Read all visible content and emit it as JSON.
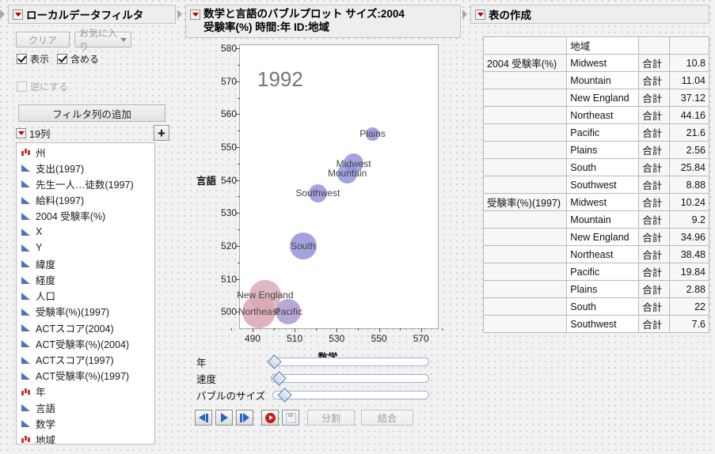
{
  "filter_panel": {
    "title": "ローカルデータフィルタ",
    "clear_label": "クリア",
    "favorites_label": "お気に入り",
    "show_label": "表示",
    "include_label": "含める",
    "invert_label": "逆にする",
    "add_filter_column_label": "フィルタ列の追加",
    "columns_count_label": "19列",
    "plus_label": "+",
    "columns": [
      {
        "label": "州",
        "type": "nominal"
      },
      {
        "label": "支出(1997)",
        "type": "continuous"
      },
      {
        "label": "先生一人…徒数(1997)",
        "type": "continuous"
      },
      {
        "label": "給料(1997)",
        "type": "continuous"
      },
      {
        "label": "2004 受験率(%)",
        "type": "continuous"
      },
      {
        "label": "X",
        "type": "continuous"
      },
      {
        "label": "Y",
        "type": "continuous"
      },
      {
        "label": "緯度",
        "type": "continuous"
      },
      {
        "label": "経度",
        "type": "continuous"
      },
      {
        "label": "人口",
        "type": "continuous"
      },
      {
        "label": "受験率(%)(1997)",
        "type": "continuous"
      },
      {
        "label": "ACTスコア(2004)",
        "type": "continuous"
      },
      {
        "label": "ACT受験率(%)(2004)",
        "type": "continuous"
      },
      {
        "label": "ACTスコア(1997)",
        "type": "continuous"
      },
      {
        "label": "ACT受験率(%)(1997)",
        "type": "continuous"
      },
      {
        "label": "年",
        "type": "nominal"
      },
      {
        "label": "言語",
        "type": "continuous"
      },
      {
        "label": "数学",
        "type": "continuous"
      },
      {
        "label": "地域",
        "type": "nominal"
      }
    ]
  },
  "graph_panel": {
    "title_line1": "数学と言語のバブルプロット サイズ:2004",
    "title_line2": "受験率(%) 時間:年  ID:地域",
    "sliders": [
      {
        "name": "年",
        "value_pct": 2
      },
      {
        "name": "速度",
        "value_pct": 4
      },
      {
        "name": "バブルのサイズ",
        "value_pct": 6
      }
    ],
    "controls": {
      "step_back": "step-back",
      "play": "play",
      "step_forward": "step-forward",
      "record": "record",
      "save": "save",
      "split_label": "分割",
      "combine_label": "結合"
    }
  },
  "chart_data": {
    "type": "scatter",
    "title": "1992",
    "xlabel": "数学",
    "ylabel": "言語",
    "xlim": [
      484,
      578
    ],
    "ylim": [
      495,
      581
    ],
    "xticks": [
      490,
      510,
      530,
      550,
      570
    ],
    "yticks": [
      500,
      510,
      520,
      530,
      540,
      550,
      560,
      570,
      580
    ],
    "grid": false,
    "legend": "none",
    "points": [
      {
        "label": "Plains",
        "x": 547,
        "y": 554,
        "size": 2.56,
        "color": "#8f90d8"
      },
      {
        "label": "Midwest",
        "x": 538,
        "y": 545,
        "size": 10.8,
        "color": "#8f90d8"
      },
      {
        "label": "Mountain",
        "x": 535,
        "y": 542,
        "size": 11.04,
        "color": "#8f90d8"
      },
      {
        "label": "Southwest",
        "x": 521,
        "y": 536,
        "size": 8.88,
        "color": "#8f90d8"
      },
      {
        "label": "South",
        "x": 514,
        "y": 520,
        "size": 25.84,
        "color": "#8f90d8"
      },
      {
        "label": "New England",
        "x": 496,
        "y": 505,
        "size": 37.12,
        "color": "#d9a8b6"
      },
      {
        "label": "Northeast",
        "x": 493,
        "y": 500,
        "size": 44.16,
        "color": "#d9a0b0"
      },
      {
        "label": "Pacific",
        "x": 507,
        "y": 500,
        "size": 21.6,
        "color": "#a995cc"
      }
    ]
  },
  "table_panel": {
    "title": "表の作成",
    "headers": [
      "",
      "地域",
      "",
      ""
    ],
    "rows": [
      {
        "group": "2004 受験率(%)",
        "region": "Midwest",
        "stat": "合計",
        "value": "10.8"
      },
      {
        "group": "",
        "region": "Mountain",
        "stat": "合計",
        "value": "11.04"
      },
      {
        "group": "",
        "region": "New England",
        "stat": "合計",
        "value": "37.12"
      },
      {
        "group": "",
        "region": "Northeast",
        "stat": "合計",
        "value": "44.16"
      },
      {
        "group": "",
        "region": "Pacific",
        "stat": "合計",
        "value": "21.6"
      },
      {
        "group": "",
        "region": "Plains",
        "stat": "合計",
        "value": "2.56"
      },
      {
        "group": "",
        "region": "South",
        "stat": "合計",
        "value": "25.84"
      },
      {
        "group": "",
        "region": "Southwest",
        "stat": "合計",
        "value": "8.88"
      },
      {
        "group": "受験率(%)(1997)",
        "region": "Midwest",
        "stat": "合計",
        "value": "10.24"
      },
      {
        "group": "",
        "region": "Mountain",
        "stat": "合計",
        "value": "9.2"
      },
      {
        "group": "",
        "region": "New England",
        "stat": "合計",
        "value": "34.96"
      },
      {
        "group": "",
        "region": "Northeast",
        "stat": "合計",
        "value": "38.48"
      },
      {
        "group": "",
        "region": "Pacific",
        "stat": "合計",
        "value": "19.84"
      },
      {
        "group": "",
        "region": "Plains",
        "stat": "合計",
        "value": "2.88"
      },
      {
        "group": "",
        "region": "South",
        "stat": "合計",
        "value": "22"
      },
      {
        "group": "",
        "region": "Southwest",
        "stat": "合計",
        "value": "7.6"
      }
    ]
  }
}
